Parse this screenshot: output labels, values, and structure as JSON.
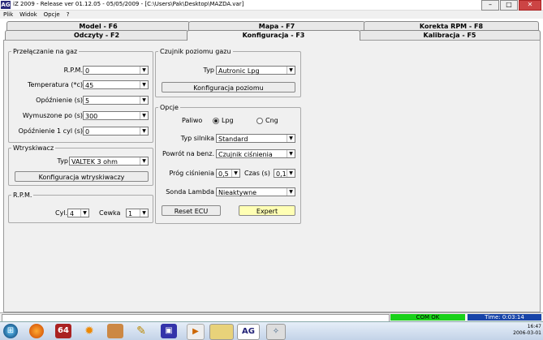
{
  "window": {
    "title": "iZ 2009 - Release  ver 01.12.05 - 05/05/2009  - [C:\\Users\\Pak\\Desktop\\MAZDA.var]",
    "logo": "AG"
  },
  "menu": [
    "Plik",
    "Widok",
    "Opcje",
    "?"
  ],
  "tabs_back": [
    "Model - F6",
    "Mapa - F7",
    "Korekta RPM - F8"
  ],
  "tabs_front": [
    "Odczyty - F2",
    "Konfiguracja - F3",
    "Kalibracja - F5"
  ],
  "active_tab": "Konfiguracja - F3",
  "switching": {
    "title": "Przełączanie na gaz",
    "fields": [
      {
        "label": "R.P.M.",
        "value": "0"
      },
      {
        "label": "Temperatura (*c)",
        "value": "45"
      },
      {
        "label": "Opóźnienie (s)",
        "value": "5"
      },
      {
        "label": "Wymuszone po (s)",
        "value": "300"
      },
      {
        "label": "Opóźnienie 1 cyl (s)",
        "value": "0"
      }
    ]
  },
  "injector": {
    "title": "Wtryskiwacz",
    "type_label": "Typ",
    "type_value": "VALTEK 3 ohm",
    "config_button": "Konfiguracja wtryskiwaczy"
  },
  "rpm": {
    "title": "R.P.M.",
    "cyl_label": "Cyl.",
    "cyl_value": "4",
    "coil_label": "Cewka",
    "coil_value": "1"
  },
  "level_sensor": {
    "title": "Czujnik poziomu gazu",
    "type_label": "Typ",
    "type_value": "Autronic Lpg",
    "config_button": "Konfiguracja poziomu"
  },
  "options": {
    "title": "Opcje",
    "fuel_label": "Paliwo",
    "fuel_options": [
      {
        "label": "Lpg",
        "selected": true
      },
      {
        "label": "Cng",
        "selected": false
      }
    ],
    "engine_type_label": "Typ silnika",
    "engine_type_value": "Standard",
    "return_label": "Powrót na benz.",
    "return_value": "Czujnik ciśnienia",
    "threshold_label": "Próg ciśnienia",
    "threshold_value": "0,5",
    "time_label": "Czas (s)",
    "time_value": "0,1",
    "lambda_label": "Sonda Lambda",
    "lambda_value": "Nieaktywne",
    "reset_button": "Reset ECU",
    "expert_button": "Expert"
  },
  "status": {
    "com": "COM OK",
    "time": "Time: 0:03:14",
    "com_color": "#19d119",
    "time_color": "#1744a8"
  },
  "taskbar": {
    "icons": [
      "start-icon",
      "firefox-icon",
      "64-icon",
      "sun-icon",
      "book-icon",
      "tool-icon",
      "floppy-icon",
      "media-icon",
      "folder-icon",
      "ag-icon",
      "clean-icon"
    ],
    "clock_time": "16:47",
    "clock_date": "2006-03-01"
  }
}
